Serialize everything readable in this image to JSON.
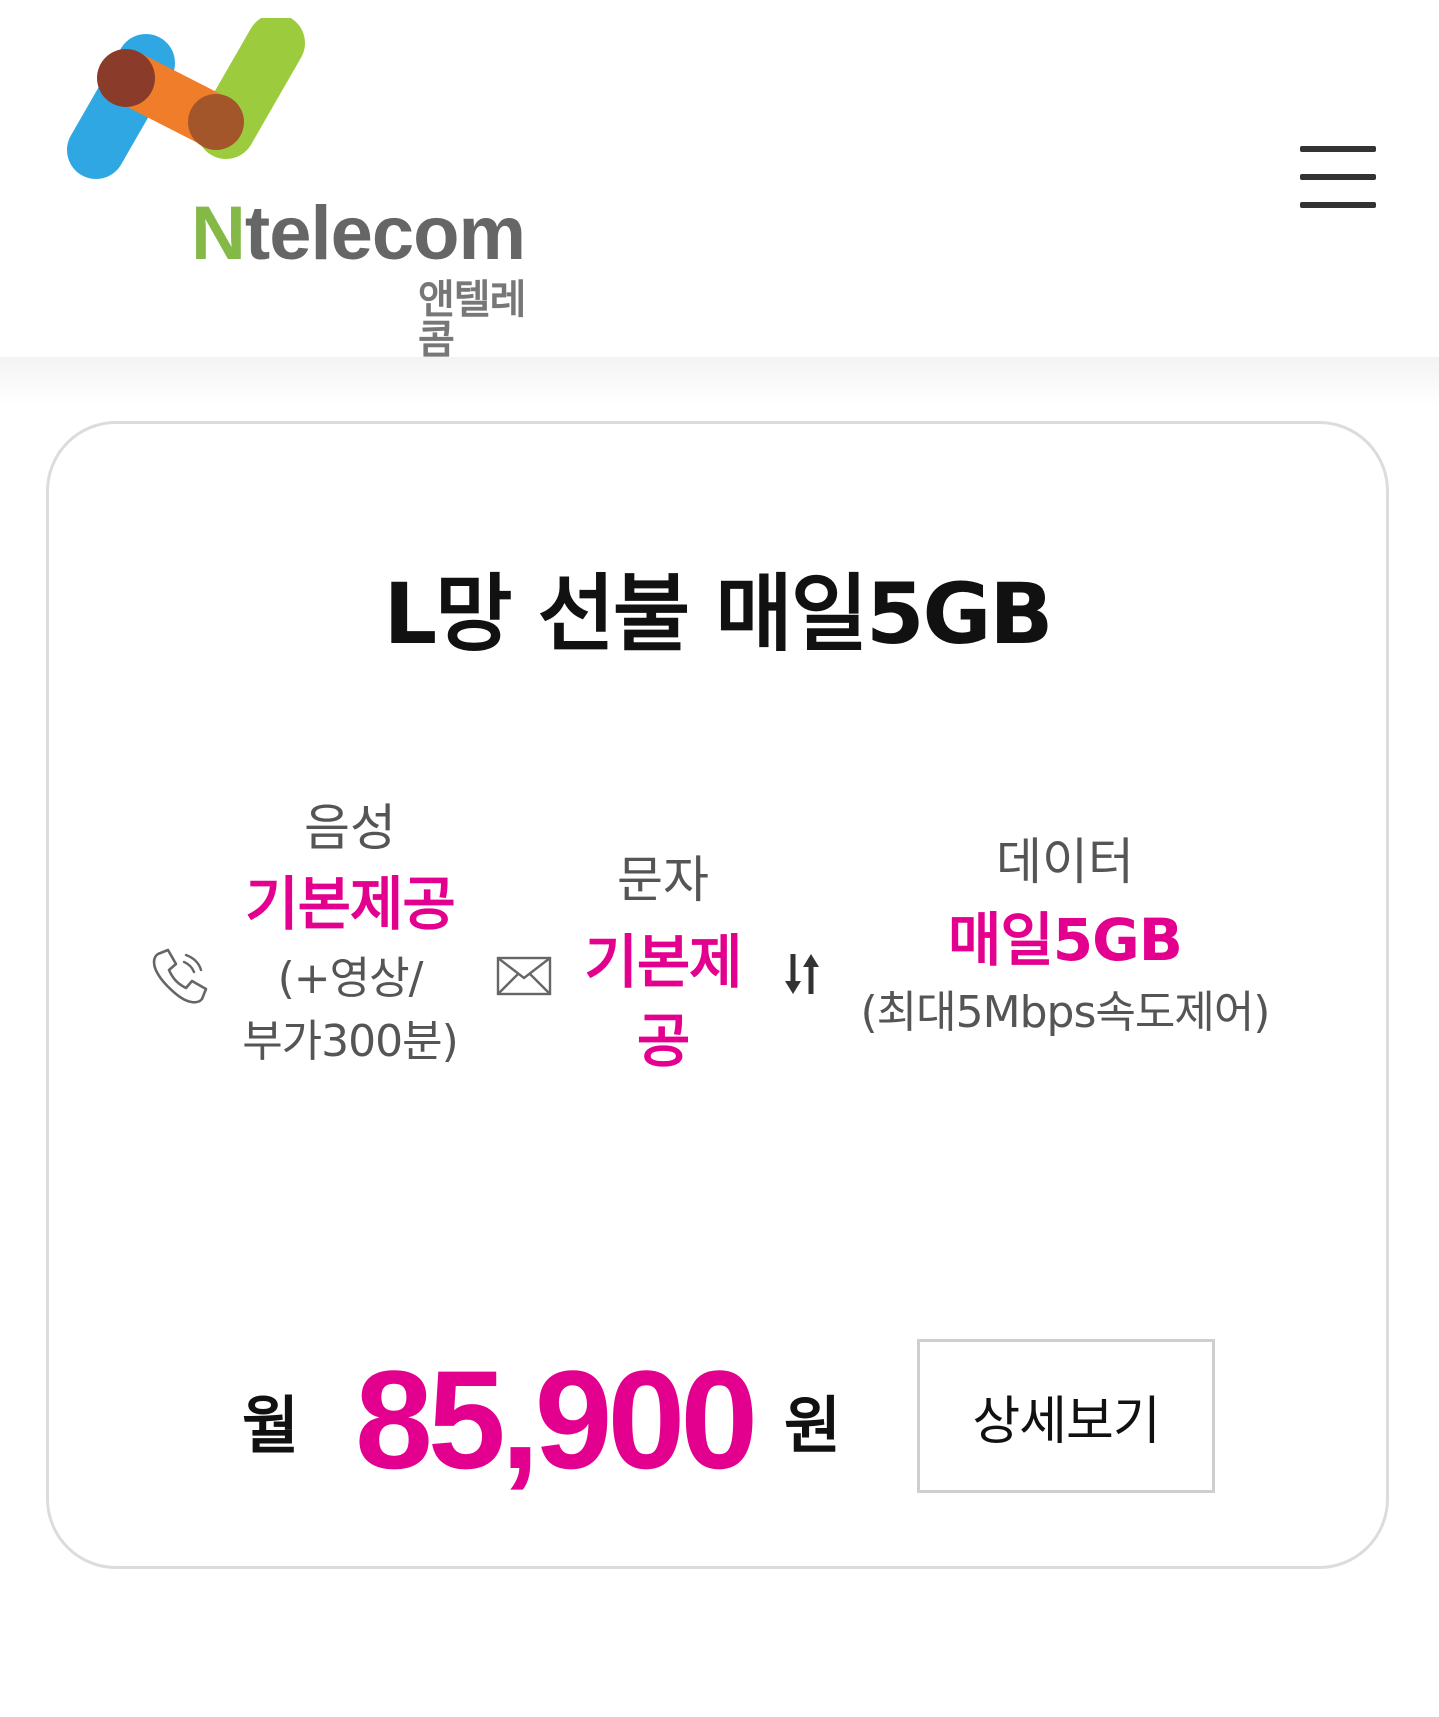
{
  "header": {
    "logo": {
      "name_en": "Ntelecom",
      "name_en_first": "N",
      "name_en_rest": "telecom",
      "name_ko": "앤텔레콤"
    },
    "menu_icon": "hamburger-menu-icon"
  },
  "plan": {
    "title": "L망 선불 매일5GB",
    "voice": {
      "icon": "phone-icon",
      "label": "음성",
      "value": "기본제공",
      "note_line1": "(+영상/",
      "note_line2": "부가300분)"
    },
    "sms": {
      "icon": "envelope-icon",
      "label": "문자",
      "value_line1": "기본제",
      "value_line2": "공"
    },
    "data": {
      "icon": "updown-arrows-icon",
      "label": "데이터",
      "value": "매일5GB",
      "note": "(최대5Mbps속도제어)"
    },
    "price": {
      "prefix": "월",
      "amount": "85,900",
      "suffix": "원"
    },
    "detail_button": "상세보기"
  },
  "colors": {
    "accent": "#e4008f",
    "text": "#111111",
    "muted": "#555555",
    "logo_green": "#84b947"
  }
}
